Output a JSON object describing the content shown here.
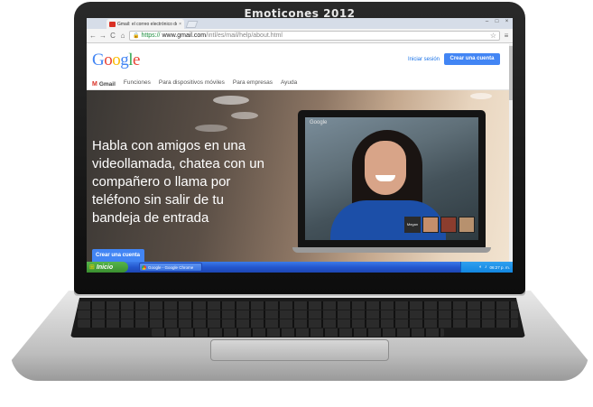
{
  "banner": {
    "title": "Emoticones 2012"
  },
  "browser": {
    "tab_title": "Gmail: el correo electrónico de Google",
    "tab_close": "×",
    "window_controls": {
      "minimize": "–",
      "maximize": "□",
      "close": "×"
    },
    "nav": {
      "back": "←",
      "forward": "→",
      "reload": "C",
      "home": "⌂"
    },
    "url": {
      "protocol": "https://",
      "host": "www.gmail.com",
      "path": "/intl/es/mail/help/about.html"
    },
    "bookmark": "☆",
    "menu": "≡"
  },
  "page": {
    "logo_letters": [
      "G",
      "o",
      "o",
      "g",
      "l",
      "e"
    ],
    "signin_label": "Iniciar sesión",
    "create_account_label": "Crear una cuenta",
    "nav": {
      "gmail": "Gmail",
      "items": [
        "Funciones",
        "Para dispositivos móviles",
        "Para empresas",
        "Ayuda"
      ]
    },
    "hero": {
      "headline": "Habla con amigos en una videollamada, chatea con un compañero o llama por teléfono sin salir de tu bandeja de entrada",
      "button_label": "Crear una cuenta",
      "mini_brand": "Google",
      "thumb_label": "Megan"
    }
  },
  "taskbar": {
    "start_label": "Inicio",
    "start_icon": "⊞",
    "task_label": "Google - Google Chrome",
    "clock": "06:27 p. m.",
    "tray_icons": [
      "◐",
      "♪"
    ]
  },
  "colors": {
    "google_blue": "#4285f4",
    "gmail_red": "#d93025",
    "xp_taskbar": "#2457cf",
    "xp_start": "#3a8f2f"
  }
}
